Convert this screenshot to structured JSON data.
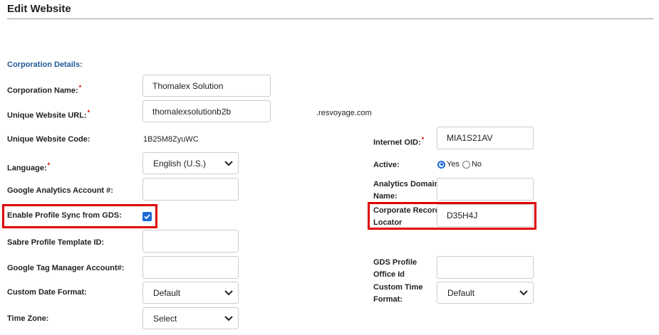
{
  "page": {
    "title": "Edit Website"
  },
  "section": {
    "title": "Corporation Details:"
  },
  "left": {
    "corporation_name": {
      "label": "Corporation Name:",
      "value": "Thomalex Solution"
    },
    "unique_url": {
      "label": "Unique Website URL:",
      "value": "thomalexsolutionb2b",
      "suffix": ".resvoyage.com"
    },
    "unique_code": {
      "label": "Unique Website Code:",
      "value": "1B25M8ZyuWC"
    },
    "language": {
      "label": "Language:",
      "value": "English (U.S.)"
    },
    "google_analytics": {
      "label": "Google Analytics Account #:",
      "value": ""
    },
    "profile_sync": {
      "label": "Enable Profile Sync from GDS:",
      "checked": true
    },
    "sabre_template": {
      "label": "Sabre Profile Template ID:",
      "value": ""
    },
    "gtm": {
      "label": "Google Tag Manager Account#:",
      "value": ""
    },
    "date_format": {
      "label": "Custom Date Format:",
      "value": "Default"
    },
    "time_zone": {
      "label": "Time Zone:",
      "value": "Select"
    }
  },
  "right": {
    "internet_oid": {
      "label": "Internet OID:",
      "value": "MIA1S21AV"
    },
    "active": {
      "label": "Active:",
      "yes": "Yes",
      "no": "No",
      "selected": "Yes"
    },
    "analytics_domain": {
      "label_line1": "Analytics Domain",
      "label_line2": "Name:",
      "value": ""
    },
    "record_locator": {
      "label_line1": "Corporate Record",
      "label_line2": "Locator",
      "value": "D35H4J"
    },
    "gds_office": {
      "label_line1": "GDS Profile",
      "label_line2": "Office Id",
      "value": ""
    },
    "time_format": {
      "label_line1": "Custom Time",
      "label_line2": "Format:",
      "value": "Default"
    }
  },
  "colors": {
    "accent": "#1d6bd4",
    "highlight": "#e00000",
    "section": "#1f5a99"
  },
  "required_mark": "*"
}
